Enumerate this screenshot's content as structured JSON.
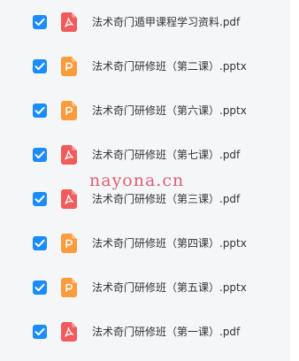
{
  "files": [
    {
      "name": "法术奇门遁甲课程学习资料.pdf",
      "type": "pdf",
      "checked": true
    },
    {
      "name": "法术奇门研修班（第二课）.pptx",
      "type": "pptx",
      "checked": true
    },
    {
      "name": "法术奇门研修班（第六课）.pptx",
      "type": "pptx",
      "checked": true
    },
    {
      "name": "法术奇门研修班（第七课）.pdf",
      "type": "pdf",
      "checked": true
    },
    {
      "name": "法术奇门研修班（第三课）.pdf",
      "type": "pdf",
      "checked": true
    },
    {
      "name": "法术奇门研修班（第四课）.pptx",
      "type": "pptx",
      "checked": true
    },
    {
      "name": "法术奇门研修班（第五课）.pptx",
      "type": "pptx",
      "checked": true
    },
    {
      "name": "法术奇门研修班（第一课）.pdf",
      "type": "pdf",
      "checked": true
    }
  ],
  "watermark": "nayona.cn",
  "colors": {
    "checkbox": "#1a8cff",
    "pdf_icon": "#f25b5b",
    "pptx_icon": "#fa9b3c",
    "text": "#333333",
    "panel_bg": "#f5f6f8",
    "watermark": "#d9455f"
  }
}
